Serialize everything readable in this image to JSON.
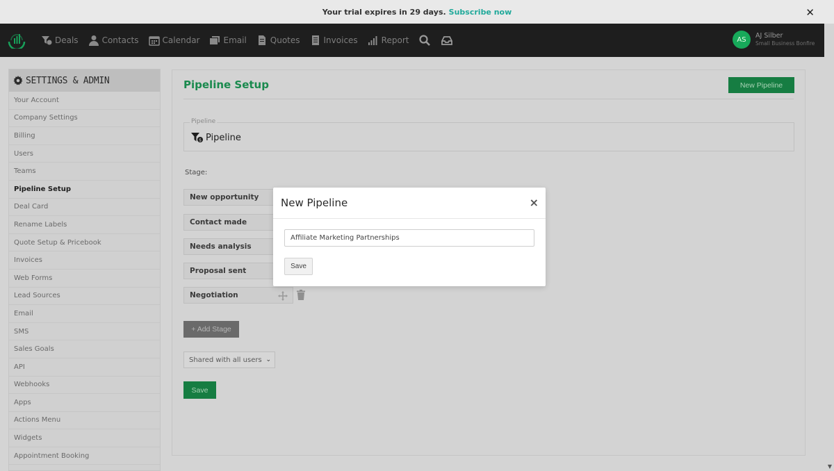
{
  "banner": {
    "text": "Your trial expires in 29 days.",
    "link": "Subscribe now",
    "close": "✕"
  },
  "nav": {
    "items": [
      {
        "label": "Deals",
        "icon": "deals-funnel-icon"
      },
      {
        "label": "Contacts",
        "icon": "contacts-person-icon"
      },
      {
        "label": "Calendar",
        "icon": "calendar-icon"
      },
      {
        "label": "Email",
        "icon": "email-icon"
      },
      {
        "label": "Quotes",
        "icon": "quotes-document-icon"
      },
      {
        "label": "Invoices",
        "icon": "invoices-document-icon"
      },
      {
        "label": "Report",
        "icon": "report-bars-icon"
      }
    ],
    "user": {
      "initials": "AS",
      "name": "AJ Silber",
      "org": "Small Business Bonfire"
    },
    "colors": {
      "bar": "#1e1e1e",
      "avatar": "#17a95a"
    }
  },
  "sidebar": {
    "title": "SETTINGS & ADMIN",
    "items": [
      "Your Account",
      "Company Settings",
      "Billing",
      "Users",
      "Teams",
      "Pipeline Setup",
      "Deal Card",
      "Rename Labels",
      "Quote Setup & Pricebook",
      "Invoices",
      "Web Forms",
      "Lead Sources",
      "Email",
      "SMS",
      "Sales Goals",
      "API",
      "Webhooks",
      "Apps",
      "Actions Menu",
      "Widgets",
      "Appointment Booking"
    ],
    "active": "Pipeline Setup"
  },
  "main": {
    "title": "Pipeline Setup",
    "new_pipeline_button": "New Pipeline",
    "pipeline_legend": "Pipeline",
    "pipeline_value": "Pipeline",
    "stage_label": "Stage:",
    "stages": [
      "New opportunity",
      "Contact made",
      "Needs analysis",
      "Proposal sent",
      "Negotiation"
    ],
    "add_stage": "+ Add Stage",
    "share_select": "Shared with all users",
    "save": "Save",
    "accent_color": "#1a8a4e"
  },
  "modal": {
    "title": "New Pipeline",
    "close": "×",
    "input_value": "Affiliate Marketing Partnerships",
    "save": "Save"
  }
}
